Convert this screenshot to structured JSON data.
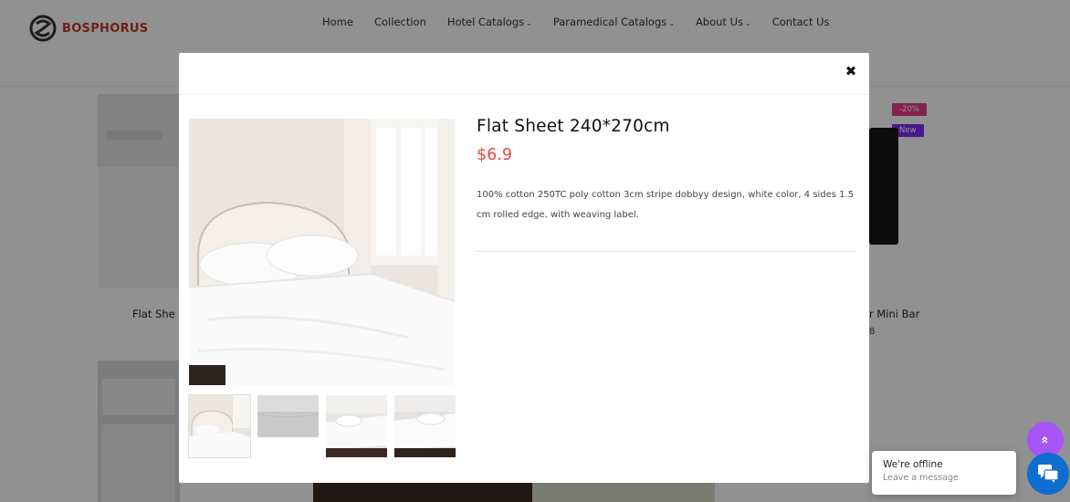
{
  "header": {
    "logo_text": "BOSPHORUS",
    "nav": [
      {
        "label": "Home",
        "has_dropdown": false
      },
      {
        "label": "Collection",
        "has_dropdown": false
      },
      {
        "label": "Hotel Catalogs",
        "has_dropdown": true
      },
      {
        "label": "Paramedical Catalogs",
        "has_dropdown": true
      },
      {
        "label": "About Us",
        "has_dropdown": true
      },
      {
        "label": "Contact Us",
        "has_dropdown": false
      }
    ]
  },
  "background": {
    "product_left_title": "Flat She",
    "product_right_title": "r Mini Bar",
    "product_right_sub": "8",
    "badge_sale": "-20%",
    "badge_new": "New"
  },
  "modal": {
    "close_icon": "close-icon",
    "title": "Flat Sheet 240*270cm",
    "price": "$6.9",
    "description": "100% cotton 250TC poly cotton 3cm stripe dobbyy design, white color, 4 sides 1.5 cm rolled edge, with weaving label."
  },
  "chat": {
    "title": "We're offline",
    "subtitle": "Leave a message",
    "chat_icon": "chat-bubble-icon"
  },
  "scroll_top": {
    "icon": "double-chevron-up-icon",
    "glyph": "»"
  },
  "colors": {
    "accent_price": "#e74c3c",
    "logo_red": "#c0392b",
    "scroll_top_purple": "#a855f7",
    "chat_blue": "#0d6ecf",
    "badge_sale": "#e83e8c",
    "badge_new": "#7b2ff7"
  }
}
